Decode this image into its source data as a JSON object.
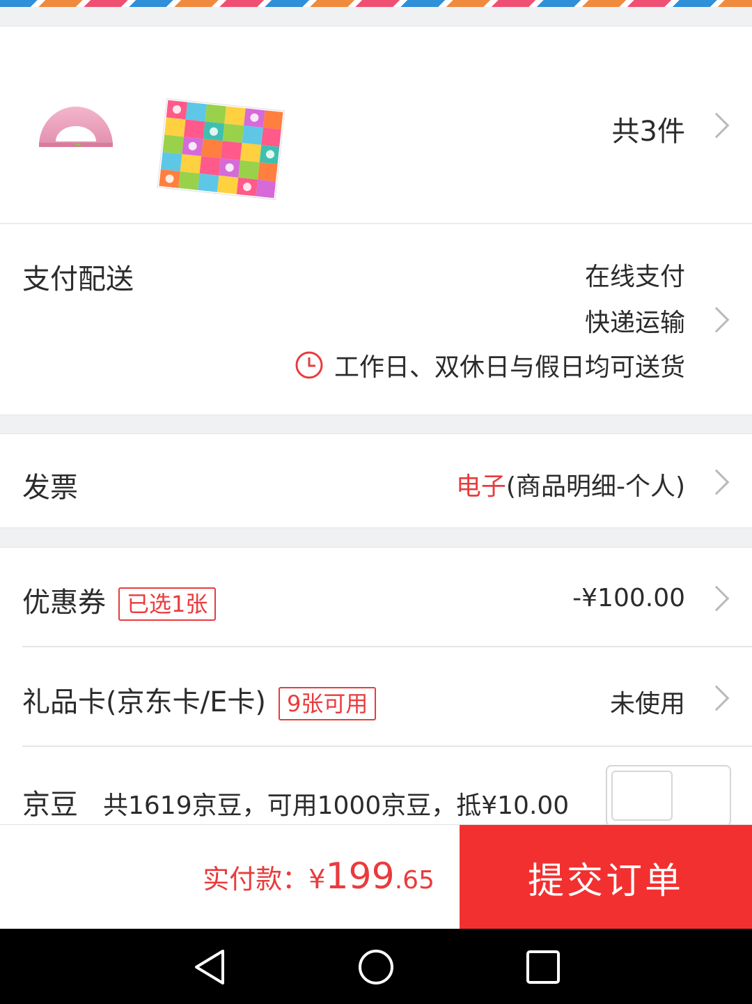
{
  "products": {
    "count_label": "共3件"
  },
  "shipping": {
    "label": "支付配送",
    "payment_method": "在线支付",
    "delivery_method": "快递运输",
    "delivery_time": "工作日、双休日与假日均可送货"
  },
  "invoice": {
    "label": "发票",
    "type": "电子",
    "detail": "(商品明细-个人)"
  },
  "coupon": {
    "label": "优惠券",
    "badge": "已选1张",
    "value": "-¥100.00"
  },
  "gift_card": {
    "label": "礼品卡(京东卡/E卡)",
    "badge": "9张可用",
    "value": "未使用"
  },
  "jingdou": {
    "label": "京豆",
    "detail": "共1619京豆，可用1000京豆，抵¥10.00",
    "enabled": false
  },
  "footer": {
    "total_label": "实付款：",
    "currency": "¥",
    "total_int": "199",
    "total_dec": ".65",
    "submit_label": "提交订单"
  },
  "colors": {
    "accent": "#f23030",
    "price_red": "#e93b3d"
  },
  "icons": [
    "chevron-right-icon",
    "clock-icon",
    "nav-back-icon",
    "nav-home-icon",
    "nav-recents-icon"
  ]
}
